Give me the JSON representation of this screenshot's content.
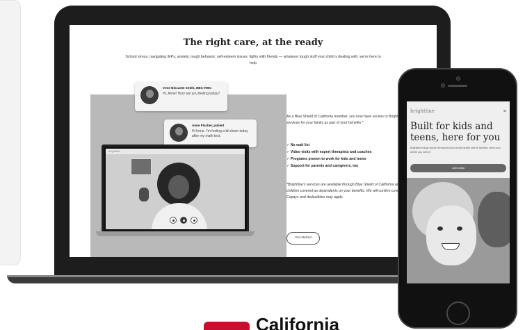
{
  "laptop_page": {
    "title": "The right care, at the ready",
    "subtitle": "School stress, navigating IEPs, anxiety, tough behavior, self-esteem issues, fights with friends — whatever tough stuff your child is dealing with, we're here to help",
    "chat": [
      {
        "name": "Irene Biscante Smith, NBC-HWC",
        "message": "Hi, Anne! How are you feeling today?"
      },
      {
        "name": "Anne Fischer, patient",
        "message": "Hi Irene. I'm feeling a bit down today after my math test."
      }
    ],
    "video_brand": "brightline",
    "info": "As a Blue Shield of California member, you now have access to Brightline's behavioral health services for your family as part of your benefits.*",
    "benefits": [
      "No wait list",
      "Video visits with expert therapists and coaches",
      "Programs proven to work for kids and teens",
      "Support for parents and caregivers, too"
    ],
    "disclaimer": "*Brightline's services are available through Blue Shield of California and your employer, for children covered as dependents on your benefits. We will confirm coverage upon sign up. Copays and deductibles may apply.",
    "cta": "Get started"
  },
  "phone_page": {
    "brand": "brightline",
    "menu_glyph": "≡",
    "headline": "Built for kids and teens, here for you",
    "sub": "Brightline brings virtual behavioral and mental health care to families, when and where you need it",
    "button": "Join today"
  },
  "footer": {
    "logo_text": "California"
  },
  "colors": {
    "brand_red": "#c8102e",
    "device_dark": "#1d1d1d"
  }
}
